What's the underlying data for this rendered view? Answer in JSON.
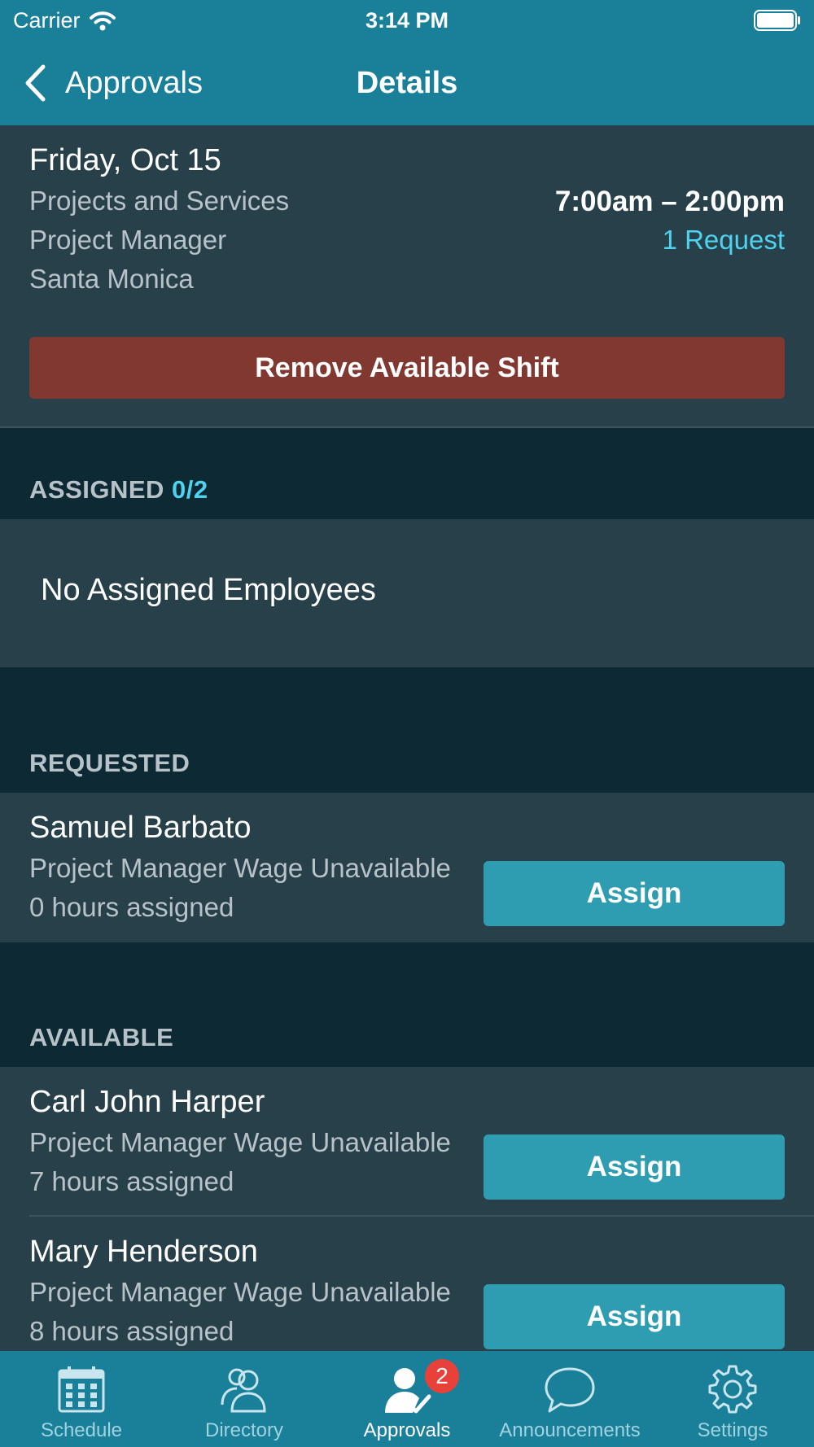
{
  "status_bar": {
    "carrier": "Carrier",
    "time": "3:14 PM"
  },
  "nav": {
    "back_label": "Approvals",
    "title": "Details"
  },
  "shift": {
    "date": "Friday, Oct 15",
    "department": "Projects and Services",
    "position": "Project Manager",
    "location": "Santa Monica",
    "time_range": "7:00am – 2:00pm",
    "requests": "1 Request",
    "remove_label": "Remove Available Shift"
  },
  "assigned": {
    "heading": "ASSIGNED",
    "count": "0/2",
    "empty_text": "No Assigned Employees"
  },
  "requested": {
    "heading": "REQUESTED",
    "employees": [
      {
        "name": "Samuel Barbato",
        "detail": "Project Manager Wage Unavailable",
        "hours": "0 hours assigned",
        "action": "Assign"
      }
    ]
  },
  "available": {
    "heading": "AVAILABLE",
    "employees": [
      {
        "name": "Carl John Harper",
        "detail": "Project Manager Wage Unavailable",
        "hours": "7 hours assigned",
        "action": "Assign"
      },
      {
        "name": "Mary Henderson",
        "detail": "Project Manager Wage Unavailable",
        "hours": "8 hours assigned",
        "action": "Assign"
      }
    ]
  },
  "tabs": [
    {
      "label": "Schedule",
      "icon": "calendar-icon",
      "active": false
    },
    {
      "label": "Directory",
      "icon": "people-icon",
      "active": false
    },
    {
      "label": "Approvals",
      "icon": "person-check-icon",
      "active": true,
      "badge": "2"
    },
    {
      "label": "Announcements",
      "icon": "speech-bubble-icon",
      "active": false
    },
    {
      "label": "Settings",
      "icon": "gear-icon",
      "active": false
    }
  ],
  "colors": {
    "header": "#1a7f99",
    "background": "#0d2933",
    "card": "#27404a",
    "accent": "#4fd2ee",
    "remove_button": "#803831",
    "assign_button": "#2e9db2",
    "badge": "#e8413a"
  }
}
